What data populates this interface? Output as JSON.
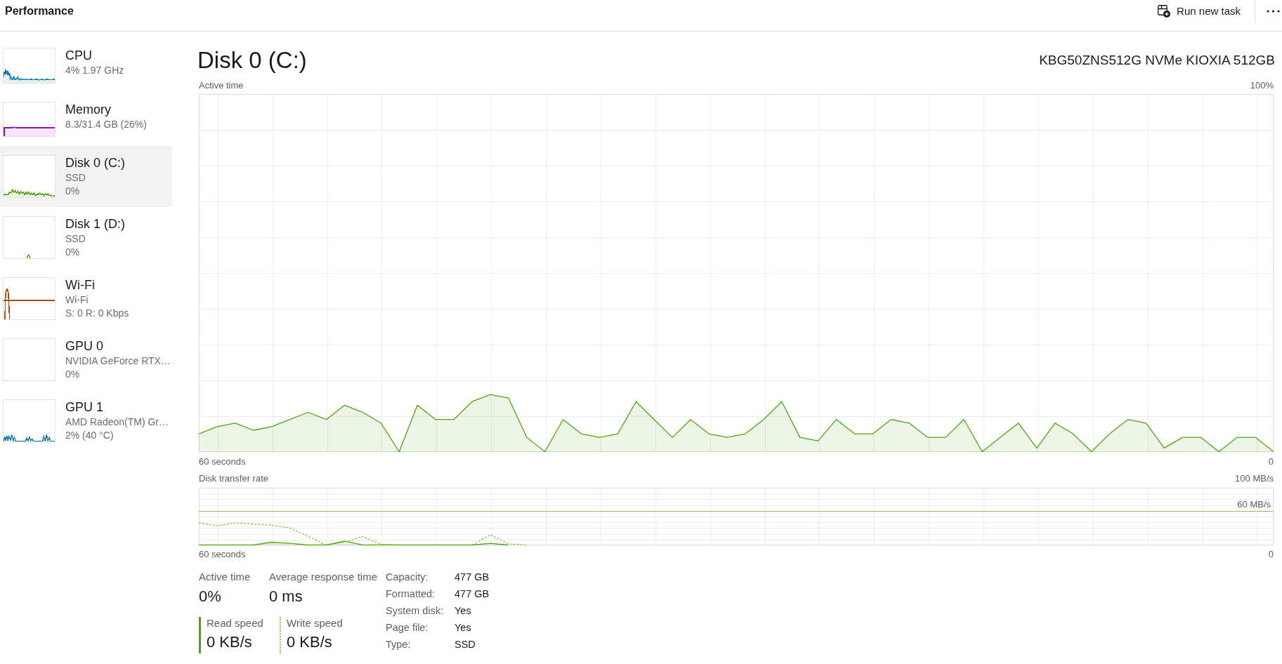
{
  "header": {
    "title": "Performance",
    "run_task_button": "Run new task"
  },
  "sidebar": {
    "items": [
      {
        "title": "CPU",
        "details": [
          "4% 1.97 GHz"
        ],
        "color": "#117dbb",
        "selected": false
      },
      {
        "title": "Memory",
        "details": [
          "8.3/31.4 GB (26%)"
        ],
        "color": "#8b12ae",
        "selected": false
      },
      {
        "title": "Disk 0 (C:)",
        "details": [
          "SSD",
          "0%"
        ],
        "color": "#4da60c",
        "selected": true
      },
      {
        "title": "Disk 1 (D:)",
        "details": [
          "SSD",
          "0%"
        ],
        "color": "#4da60c",
        "selected": false
      },
      {
        "title": "Wi-Fi",
        "details": [
          "Wi-Fi",
          "S: 0 R: 0 Kbps"
        ],
        "color": "#a74f01",
        "selected": false
      },
      {
        "title": "GPU 0",
        "details": [
          "NVIDIA GeForce RTX…",
          "0%"
        ],
        "selected": false
      },
      {
        "title": "GPU 1",
        "details": [
          "AMD Radeon(TM) Gr…",
          "2% (40 °C)"
        ],
        "color": "#117dbb",
        "selected": false
      }
    ]
  },
  "main": {
    "title": "Disk 0 (C:)",
    "model": "KBG50ZNS512G NVMe KIOXIA 512GB",
    "active_time_chart": {
      "title": "Active time",
      "max_label": "100%",
      "span_label": "60 seconds",
      "min_label": "0"
    },
    "transfer_rate_chart": {
      "title": "Disk transfer rate",
      "max_label": "100 MB/s",
      "marker_label": "60 MB/s",
      "span_label": "60 seconds",
      "min_label": "0"
    },
    "stats": [
      {
        "label": "Active time",
        "value": "0%"
      },
      {
        "label": "Average response time",
        "value": "0 ms"
      }
    ],
    "speeds": [
      {
        "kind": "read",
        "label": "Read speed",
        "value": "0 KB/s"
      },
      {
        "kind": "write",
        "label": "Write speed",
        "value": "0 KB/s"
      }
    ],
    "properties": [
      {
        "label": "Capacity:",
        "value": "477 GB"
      },
      {
        "label": "Formatted:",
        "value": "477 GB"
      },
      {
        "label": "System disk:",
        "value": "Yes"
      },
      {
        "label": "Page file:",
        "value": "Yes"
      },
      {
        "label": "Type:",
        "value": "SSD"
      }
    ]
  }
}
